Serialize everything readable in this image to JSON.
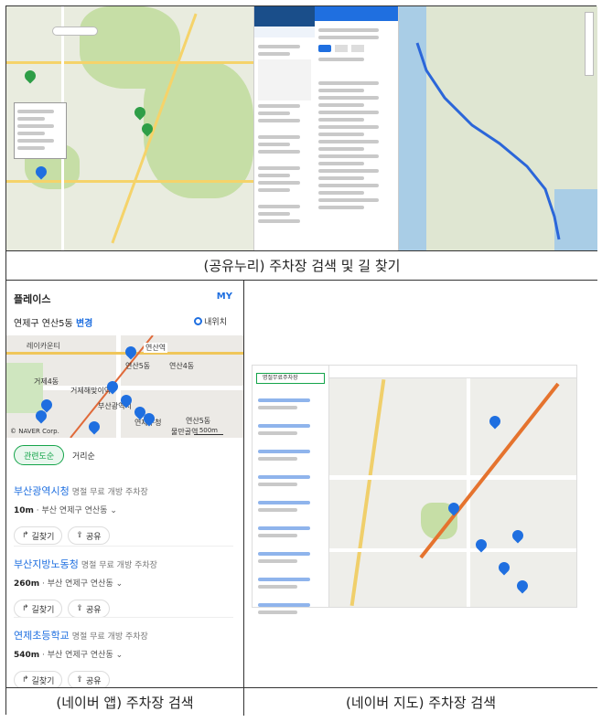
{
  "captions": {
    "top": "(공유누리) 주차장 검색 및 길 찾기",
    "bottom_left": "(네이버 앱) 주차장 검색",
    "bottom_right": "(네이버 지도) 주차장 검색"
  },
  "naver_app": {
    "header": "플레이스",
    "my": "MY",
    "location": "연제구 연산5동",
    "change": "변경",
    "my_location": "내위치",
    "map_labels": [
      "레이카운티",
      "거제해맞이역",
      "연산역",
      "연산5동",
      "연산4동",
      "거제4동",
      "부산광역시",
      "연제구청",
      "연산5동",
      "물만골역",
      "연산로",
      "© NAVER Corp."
    ],
    "scale": "500m",
    "tabs": [
      "관련도순",
      "거리순"
    ],
    "items": [
      {
        "name": "부산광역시청",
        "tag": "명절 무료 개방 주차장",
        "distance": "10m",
        "address": "부산 연제구 연산동"
      },
      {
        "name": "부산지방노동청",
        "tag": "명절 무료 개방 주차장",
        "distance": "260m",
        "address": "부산 연제구 연산동"
      },
      {
        "name": "연제초등학교",
        "tag": "명절 무료 개방 주차장",
        "distance": "540m",
        "address": "부산 연제구 연산동"
      }
    ],
    "buttons": {
      "route": "길찾기",
      "share": "공유"
    }
  },
  "naver_map": {
    "search_value": "명절무료주차장"
  },
  "colors": {
    "accent_blue": "#1f6fe0",
    "accent_green": "#14a44a",
    "park_green": "#2e9e47"
  }
}
